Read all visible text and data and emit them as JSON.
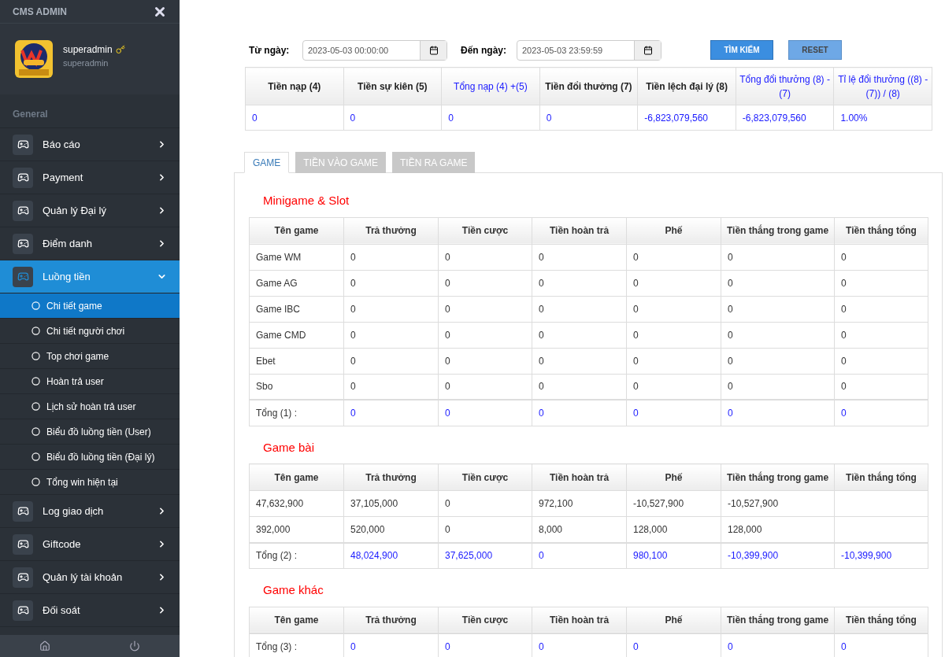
{
  "sidebar": {
    "brand": "CMS ADMIN",
    "user": {
      "name": "superadmin",
      "role": "superadmin"
    },
    "section": "General",
    "items": [
      {
        "label": "Báo cáo",
        "selected": false,
        "expanded": false
      },
      {
        "label": "Payment",
        "selected": false,
        "expanded": false
      },
      {
        "label": "Quản lý Đại lý",
        "selected": false,
        "expanded": false
      },
      {
        "label": "Điểm danh",
        "selected": false,
        "expanded": false
      },
      {
        "label": "Luồng tiền",
        "selected": true,
        "expanded": true,
        "children": [
          {
            "label": "Chi tiết game",
            "selected": true
          },
          {
            "label": "Chi tiết người chơi",
            "selected": false
          },
          {
            "label": "Top chơi game",
            "selected": false
          },
          {
            "label": "Hoàn trả user",
            "selected": false
          },
          {
            "label": "Lịch sử hoàn trả user",
            "selected": false
          },
          {
            "label": "Biểu đồ luồng tiền (User)",
            "selected": false
          },
          {
            "label": "Biểu đồ luồng tiền (Đại lý)",
            "selected": false
          },
          {
            "label": "Tổng win hiện tại",
            "selected": false
          }
        ]
      },
      {
        "label": "Log giao dịch",
        "selected": false,
        "expanded": false
      },
      {
        "label": "Giftcode",
        "selected": false,
        "expanded": false
      },
      {
        "label": "Quản lý tài khoản",
        "selected": false,
        "expanded": false
      },
      {
        "label": "Đối soát",
        "selected": false,
        "expanded": false
      }
    ]
  },
  "filters": {
    "from_label": "Từ ngày:",
    "from_value": "2023-05-03 00:00:00",
    "to_label": "Đến ngày:",
    "to_value": "2023-05-03 23:59:59",
    "search_button": "TÌM KIẾM",
    "reset_button": "RESET"
  },
  "summary": {
    "columns": [
      {
        "label": "Tiền nạp (4)",
        "highlighted": false
      },
      {
        "label": "Tiền sự kiên (5)",
        "highlighted": false
      },
      {
        "label": "Tổng nạp (4) +(5)",
        "highlighted": true
      },
      {
        "label": "Tiền đổi thưởng (7)",
        "highlighted": false
      },
      {
        "label": "Tiền lệch đại lý (8)",
        "highlighted": false
      },
      {
        "label": "Tổng đổi thưởng (8) - (7)",
        "highlighted": true
      },
      {
        "label": "Tỉ lệ đổi thưởng ((8) -(7)) / (8)",
        "highlighted": true
      }
    ],
    "values": [
      "0",
      "0",
      "0",
      "0",
      "-6,823,079,560",
      "-6,823,079,560",
      "1.00%"
    ]
  },
  "tabs": [
    {
      "label": "GAME",
      "selected": true
    },
    {
      "label": "TIỀN VÀO GAME",
      "selected": false
    },
    {
      "label": "TIỀN RA GAME",
      "selected": false
    }
  ],
  "sections": [
    {
      "title": "Minigame & Slot",
      "columns": [
        "Tên game",
        "Trả thưởng",
        "Tiền cược",
        "Tiền hoàn trả",
        "Phế",
        "Tiền thắng trong game",
        "Tiền thắng tổng"
      ],
      "rows": [
        [
          "Game WM",
          "0",
          "0",
          "0",
          "0",
          "0",
          "0"
        ],
        [
          "Game AG",
          "0",
          "0",
          "0",
          "0",
          "0",
          "0"
        ],
        [
          "Game IBC",
          "0",
          "0",
          "0",
          "0",
          "0",
          "0"
        ],
        [
          "Game CMD",
          "0",
          "0",
          "0",
          "0",
          "0",
          "0"
        ],
        [
          "Ebet",
          "0",
          "0",
          "0",
          "0",
          "0",
          "0"
        ],
        [
          "Sbo",
          "0",
          "0",
          "0",
          "0",
          "0",
          "0"
        ]
      ],
      "total": [
        "Tổng (1) :",
        "0",
        "0",
        "0",
        "0",
        "0",
        "0"
      ]
    },
    {
      "title": "Game bài",
      "columns": [
        "Tên game",
        "Trả thưởng",
        "Tiền cược",
        "Tiền hoàn trả",
        "Phế",
        "Tiền thắng trong game",
        "Tiền thắng tổng"
      ],
      "rows": [
        [
          "47,632,900",
          "37,105,000",
          "0",
          "972,100",
          "-10,527,900",
          "-10,527,900"
        ],
        [
          "392,000",
          "520,000",
          "0",
          "8,000",
          "128,000",
          "128,000"
        ]
      ],
      "total": [
        "Tổng (2) :",
        "48,024,900",
        "37,625,000",
        "0",
        "980,100",
        "-10,399,900",
        "-10,399,900"
      ]
    },
    {
      "title": "Game khác",
      "columns": [
        "Tên game",
        "Trả thưởng",
        "Tiền cược",
        "Tiền hoàn trả",
        "Phế",
        "Tiền thắng trong game",
        "Tiền thắng tổng"
      ],
      "total": [
        "Tổng (3) :",
        "0",
        "0",
        "0",
        "0",
        "0",
        "0"
      ]
    }
  ]
}
